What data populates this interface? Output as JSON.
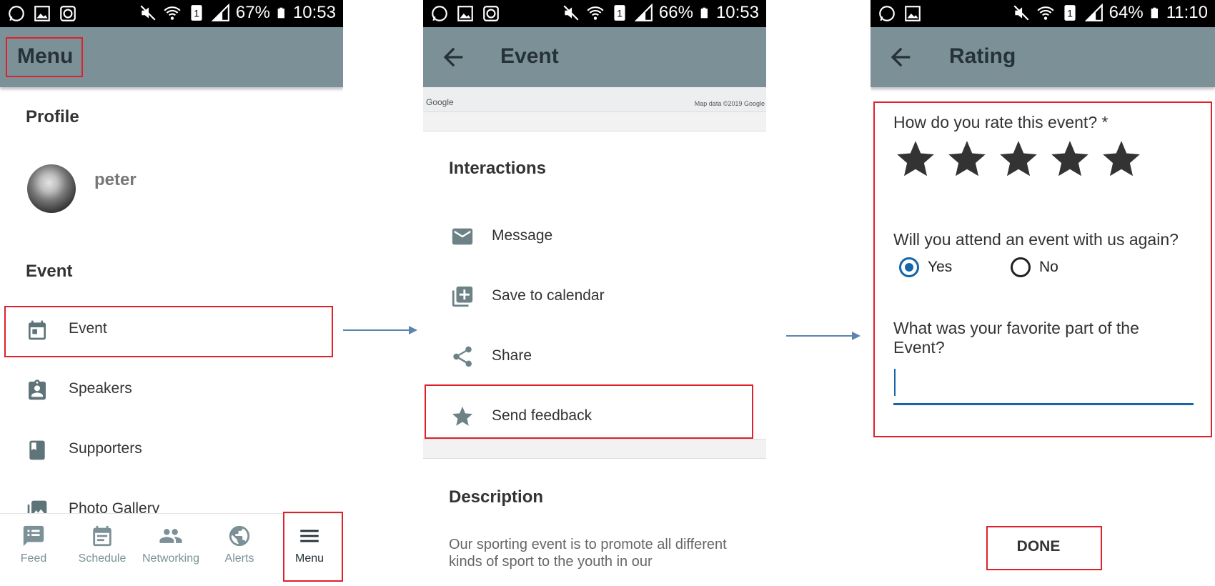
{
  "screens": {
    "menu": {
      "status": {
        "battery": "67%",
        "time": "10:53"
      },
      "title": "Menu",
      "profile_heading": "Profile",
      "username": "peter",
      "event_heading": "Event",
      "items": [
        {
          "label": "Event",
          "icon": "calendar-icon"
        },
        {
          "label": "Speakers",
          "icon": "badge-icon"
        },
        {
          "label": "Supporters",
          "icon": "bookmark-icon"
        },
        {
          "label": "Photo Gallery",
          "icon": "photo-icon"
        }
      ],
      "bottom_nav": [
        {
          "label": "Feed",
          "icon": "feed-icon"
        },
        {
          "label": "Schedule",
          "icon": "schedule-icon"
        },
        {
          "label": "Networking",
          "icon": "people-icon"
        },
        {
          "label": "Alerts",
          "icon": "globe-icon"
        },
        {
          "label": "Menu",
          "icon": "hamburger-icon",
          "active": true
        }
      ]
    },
    "event": {
      "status": {
        "battery": "66%",
        "time": "10:53"
      },
      "title": "Event",
      "map": {
        "logo": "Google",
        "attribution": "Map data ©2019 Google"
      },
      "interactions_heading": "Interactions",
      "interactions": [
        {
          "label": "Message",
          "icon": "mail-icon"
        },
        {
          "label": "Save to calendar",
          "icon": "add-calendar-icon"
        },
        {
          "label": "Share",
          "icon": "share-icon"
        },
        {
          "label": "Send feedback",
          "icon": "star-icon"
        }
      ],
      "description_heading": "Description",
      "description": "Our sporting event is to promote all different kinds of sport to the youth in our"
    },
    "rating": {
      "status": {
        "battery": "64%",
        "time": "11:10"
      },
      "title": "Rating",
      "q1": "How do you rate this event? *",
      "stars": 5,
      "q2": "Will you attend an event with us again?",
      "options": {
        "yes": "Yes",
        "no": "No",
        "selected": "Yes"
      },
      "q3": "What was your favorite part of the Event?",
      "q3_value": "",
      "done_label": "DONE"
    }
  },
  "colors": {
    "appbar": "#7b9197",
    "highlight": "#e0202b",
    "accent": "#1565a8",
    "arrow": "#5b84b1"
  }
}
